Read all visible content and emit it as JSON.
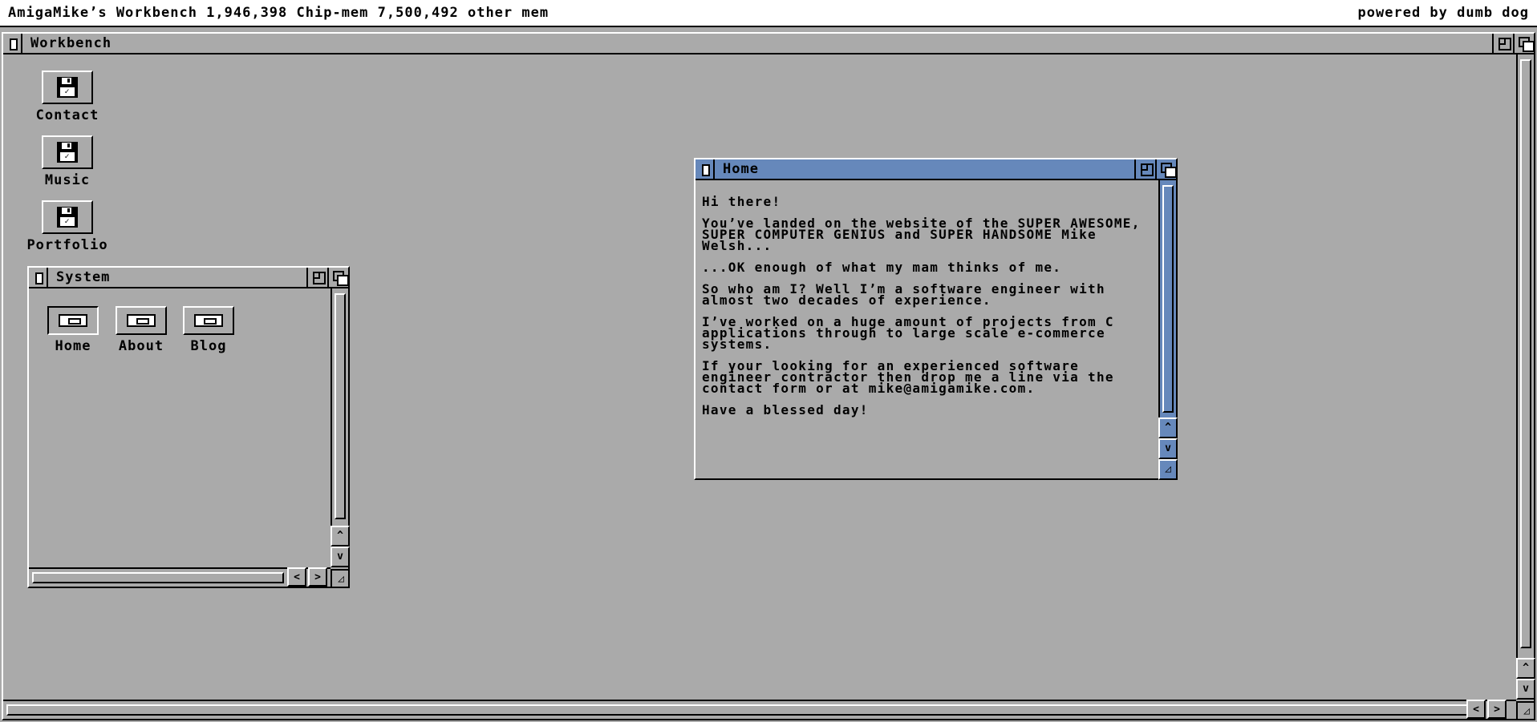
{
  "screen": {
    "title": "AmigaMike’s Workbench 1,946,398 Chip-mem 7,500,492 other mem",
    "right_text": "powered by dumb dog"
  },
  "workbench": {
    "title": "Workbench"
  },
  "desktop_icons": [
    {
      "label": "Contact"
    },
    {
      "label": "Music"
    },
    {
      "label": "Portfolio"
    }
  ],
  "system_window": {
    "title": "System",
    "drawers": [
      {
        "label": "Home"
      },
      {
        "label": "About"
      },
      {
        "label": "Blog"
      }
    ]
  },
  "home_window": {
    "title": "Home",
    "paragraphs": [
      "Hi there!",
      "You’ve landed on the website of the SUPER AWESOME, SUPER COMPUTER GENIUS and SUPER HANDSOME Mike Welsh...",
      "...OK enough of what my mam thinks of me.",
      "So who am I? Well I’m a software engineer with almost two decades of experience.",
      "I’ve worked on a huge amount of projects from C applications through to large scale e-commerce systems.",
      "If your looking for an experienced software engineer contractor then drop me a line via the contact form or at mike@amigamike.com.",
      "Have a blessed day!"
    ]
  },
  "gadgets": {
    "up": "^",
    "down": "v",
    "left": "<",
    "right": ">",
    "size": "◿"
  },
  "colors": {
    "desktop": "#aaaaaa",
    "active_title": "#6688bb",
    "screenbar": "#ffffff"
  }
}
